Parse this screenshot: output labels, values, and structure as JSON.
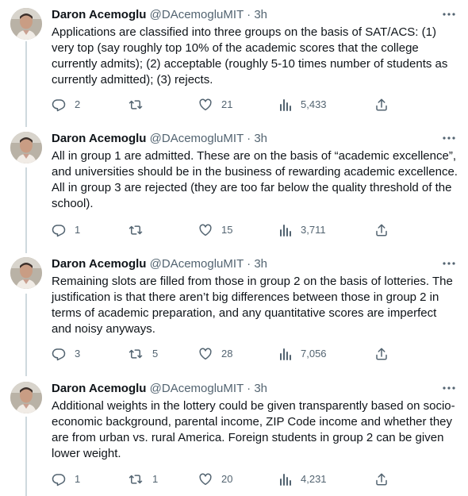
{
  "colors": {
    "text": "#0f1419",
    "secondary": "#536471",
    "thread_line": "#cfd9de"
  },
  "icons": {
    "reply": "reply-icon",
    "retweet": "retweet-icon",
    "like": "heart-icon",
    "views": "views-chart-icon",
    "share": "share-icon",
    "more": "more-dots-icon"
  },
  "tweets": [
    {
      "name": "Daron Acemoglu",
      "handle": "@DAcemogluMIT",
      "dot": "·",
      "time": "3h",
      "text": "Applications are classified into three groups on the basis of SAT/ACS: (1) very top (say roughly top 10% of the academic scores that the college currently admits); (2) acceptable (roughly 5-10 times number of students as currently admitted); (3) rejects.",
      "replies": "2",
      "retweets": "",
      "likes": "21",
      "views": "5,433"
    },
    {
      "name": "Daron Acemoglu",
      "handle": "@DAcemogluMIT",
      "dot": "·",
      "time": "3h",
      "text": "All in group 1 are admitted. These are on the basis of “academic excellence”, and universities should be in the business of rewarding academic excellence. All in group 3 are rejected (they are too far below the quality threshold of the school).",
      "replies": "1",
      "retweets": "",
      "likes": "15",
      "views": "3,711"
    },
    {
      "name": "Daron Acemoglu",
      "handle": "@DAcemogluMIT",
      "dot": "·",
      "time": "3h",
      "text": "Remaining slots are filled from those in group 2 on the basis of lotteries. The justification is that there aren’t big differences between those in group 2 in terms of academic preparation, and any quantitative scores are imperfect and noisy anyways.",
      "replies": "3",
      "retweets": "5",
      "likes": "28",
      "views": "7,056"
    },
    {
      "name": "Daron Acemoglu",
      "handle": "@DAcemogluMIT",
      "dot": "·",
      "time": "3h",
      "text": "Additional weights in the lottery could be given transparently based on socio-economic background, parental income, ZIP Code income and whether they are from urban vs. rural America. Foreign students in group 2 can be given lower weight.",
      "replies": "1",
      "retweets": "1",
      "likes": "20",
      "views": "4,231"
    }
  ]
}
